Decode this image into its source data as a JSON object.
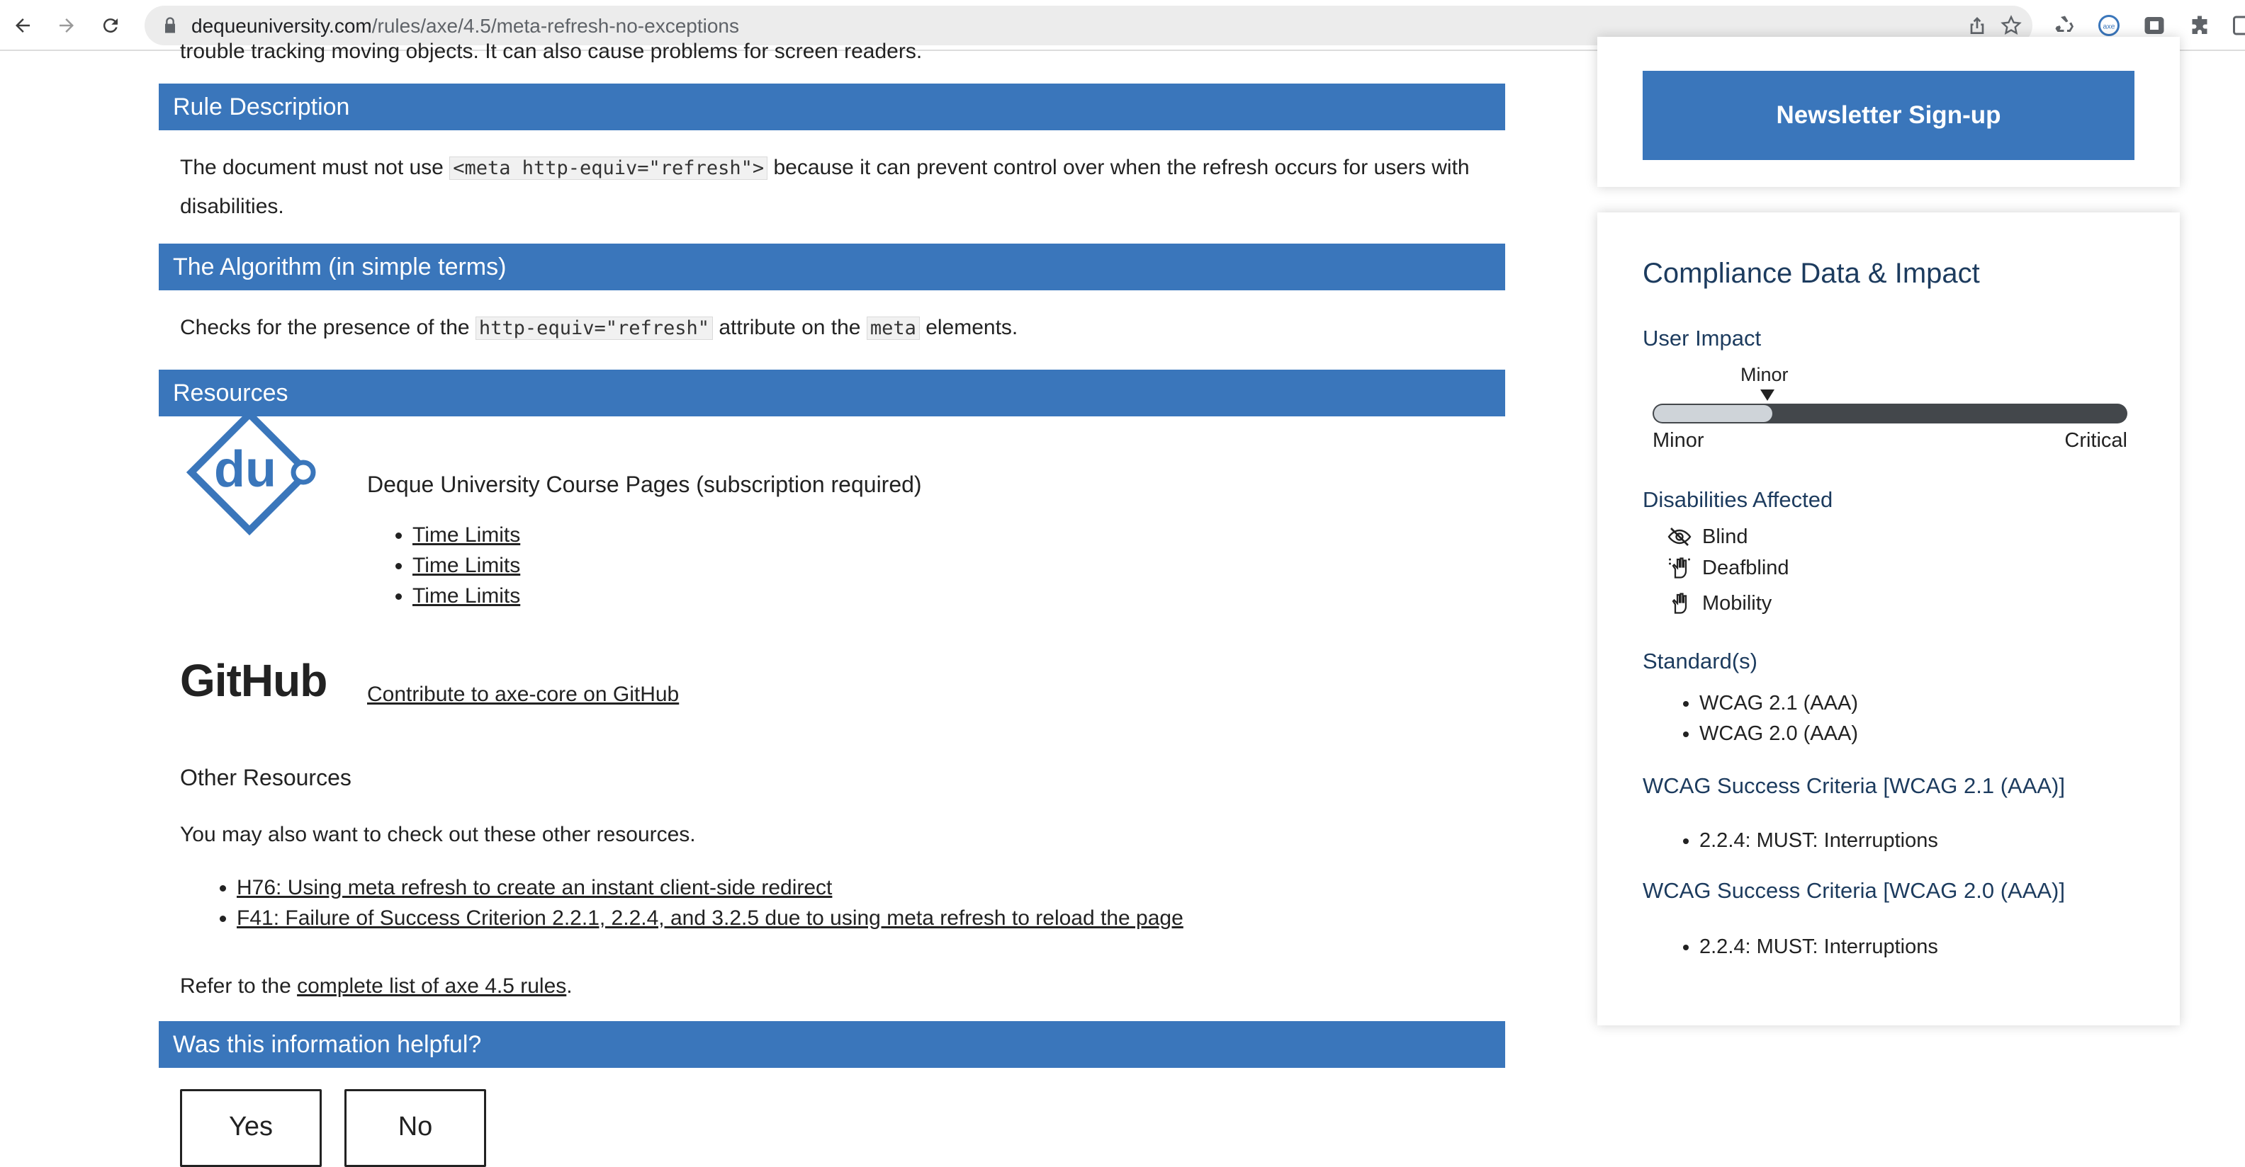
{
  "browser": {
    "url_host": "dequeuniversity.com",
    "url_path": "/rules/axe/4.5/meta-refresh-no-exceptions"
  },
  "main": {
    "cutoff_text": "trouble tracking moving objects. It can also cause problems for screen readers.",
    "rule_description": {
      "heading": "Rule Description",
      "text_before": "The document must not use ",
      "code": "<meta http-equiv=\"refresh\">",
      "text_after": " because it can prevent control over when the refresh occurs for users with disabilities."
    },
    "algorithm": {
      "heading": "The Algorithm (in simple terms)",
      "text_before": "Checks for the presence of the ",
      "code1": "http-equiv=\"refresh\"",
      "text_middle": " attribute on the ",
      "code2": "meta",
      "text_after": " elements."
    },
    "resources": {
      "heading": "Resources",
      "course_title": "Deque University Course Pages (subscription required)",
      "course_links": [
        "Time Limits",
        "Time Limits",
        "Time Limits"
      ],
      "du_logo_text": "du",
      "github_logo": "GitHub",
      "github_link": "Contribute to axe-core on GitHub",
      "other_title": "Other Resources",
      "other_desc": "You may also want to check out these other resources.",
      "other_links": [
        "H76: Using meta refresh to create an instant client-side redirect",
        "F41: Failure of Success Criterion 2.2.1, 2.2.4, and 3.2.5 due to using meta refresh to reload the page"
      ],
      "refer_before": "Refer to the ",
      "refer_link": "complete list of axe 4.5 rules",
      "refer_after": "."
    },
    "helpful": {
      "heading": "Was this information helpful?",
      "yes": "Yes",
      "no": "No"
    }
  },
  "sidebar": {
    "newsletter_label": "Newsletter Sign-up",
    "compliance_title": "Compliance Data & Impact",
    "user_impact_label": "User Impact",
    "impact_value": "Minor",
    "impact_fraction": 0.25,
    "impact_min_label": "Minor",
    "impact_max_label": "Critical",
    "disabilities_label": "Disabilities Affected",
    "disabilities": [
      {
        "label": "Blind",
        "icon": "eye-slash-icon"
      },
      {
        "label": "Deafblind",
        "icon": "deafblind-hand-icon"
      },
      {
        "label": "Mobility",
        "icon": "hand-icon"
      }
    ],
    "standards_label": "Standard(s)",
    "standards": [
      "WCAG 2.1 (AAA)",
      "WCAG 2.0 (AAA)"
    ],
    "criteria_21_label": "WCAG Success Criteria [WCAG 2.1 (AAA)]",
    "criteria_21": [
      "2.2.4: MUST: Interruptions"
    ],
    "criteria_20_label": "WCAG Success Criteria [WCAG 2.0 (AAA)]",
    "criteria_20": [
      "2.2.4: MUST: Interruptions"
    ]
  },
  "colors": {
    "section_bar": "#3a76bb",
    "heading_text": "#1c3b5e"
  }
}
